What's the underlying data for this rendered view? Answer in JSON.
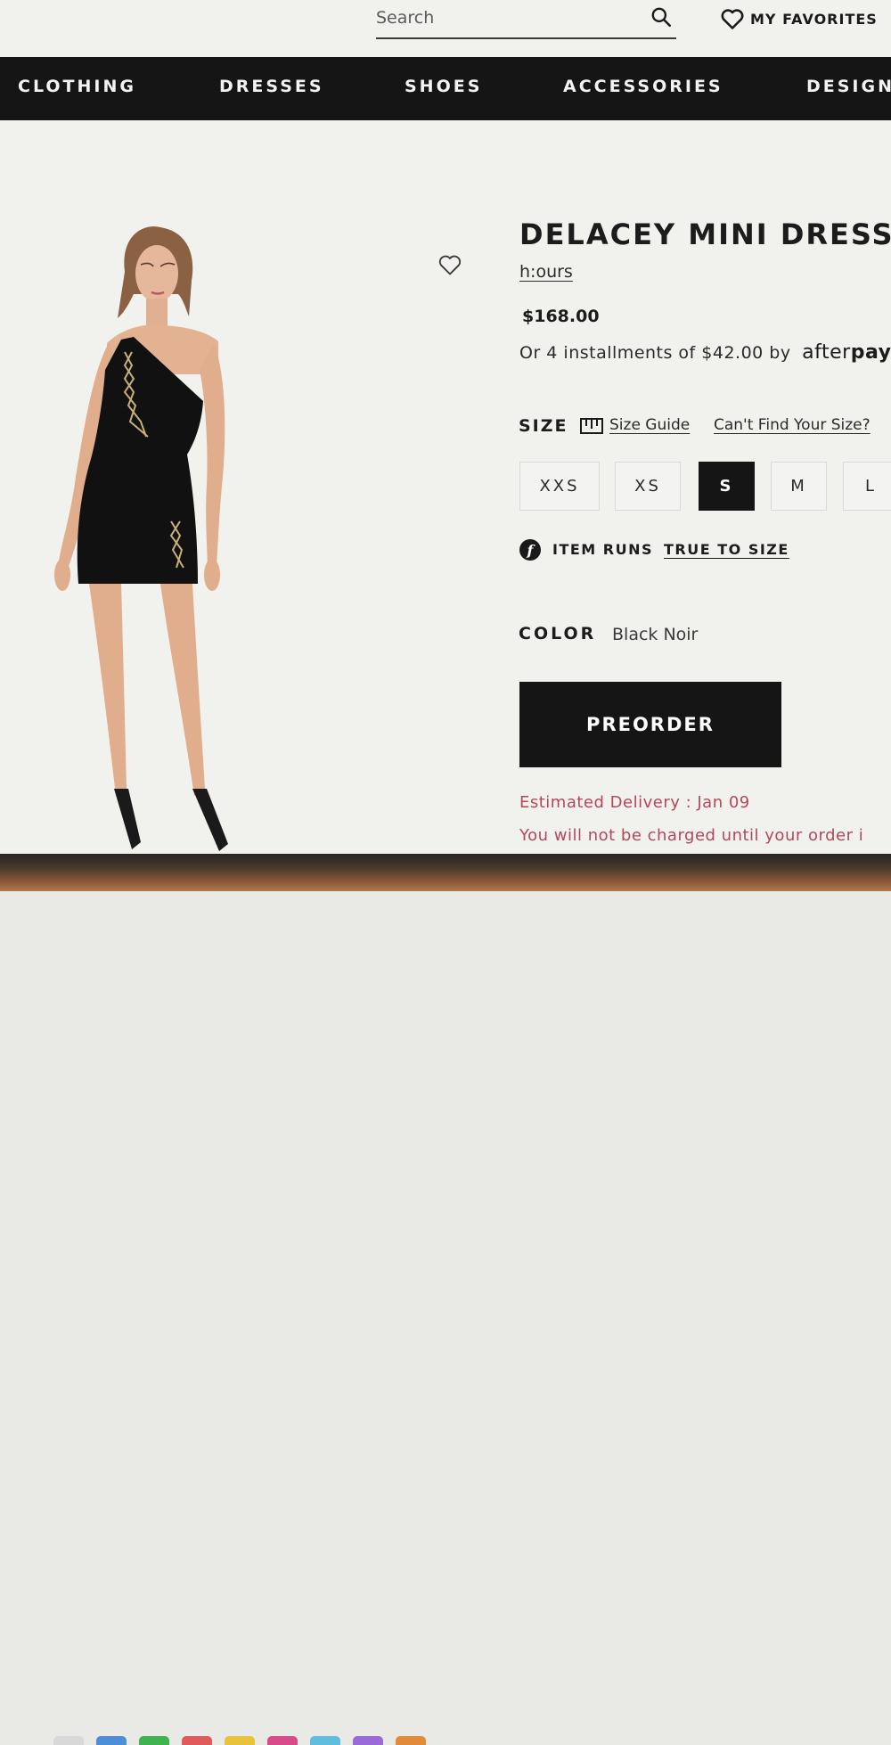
{
  "header": {
    "search_placeholder": "Search",
    "favorites_label": "MY FAVORITES"
  },
  "nav": {
    "items": [
      "CLOTHING",
      "DRESSES",
      "SHOES",
      "ACCESSORIES",
      "DESIGN"
    ]
  },
  "product": {
    "title": "DELACEY MINI DRESS",
    "brand": "h:ours",
    "price": "$168.00",
    "installments_text": "Or 4 installments of $42.00 by",
    "afterpay_light": "after",
    "afterpay_bold": "pay",
    "size": {
      "label": "SIZE",
      "guide_link": "Size Guide",
      "cant_find_link": "Can't Find Your Size?",
      "options": [
        "XXS",
        "XS",
        "S",
        "M",
        "L"
      ],
      "selected": "S"
    },
    "fit": {
      "icon_letter": "f",
      "prefix": "ITEM RUNS",
      "link": "TRUE TO SIZE"
    },
    "color": {
      "label": "COLOR",
      "value": "Black Noir"
    },
    "cta_label": "PREORDER",
    "delivery_text": "Estimated Delivery : Jan 09",
    "charge_note": "You will not be charged until your order i"
  },
  "icons": {
    "search": "search-icon",
    "favorites": "heart-icon",
    "wishlist": "heart-outline-icon",
    "size_guide": "ruler-icon",
    "fit": "fit-predictor-icon"
  },
  "colors": {
    "nav_bg": "#151515",
    "page_bg": "#f1f1ee",
    "accent_text": "#b4485a",
    "selected_size_bg": "#151515"
  }
}
